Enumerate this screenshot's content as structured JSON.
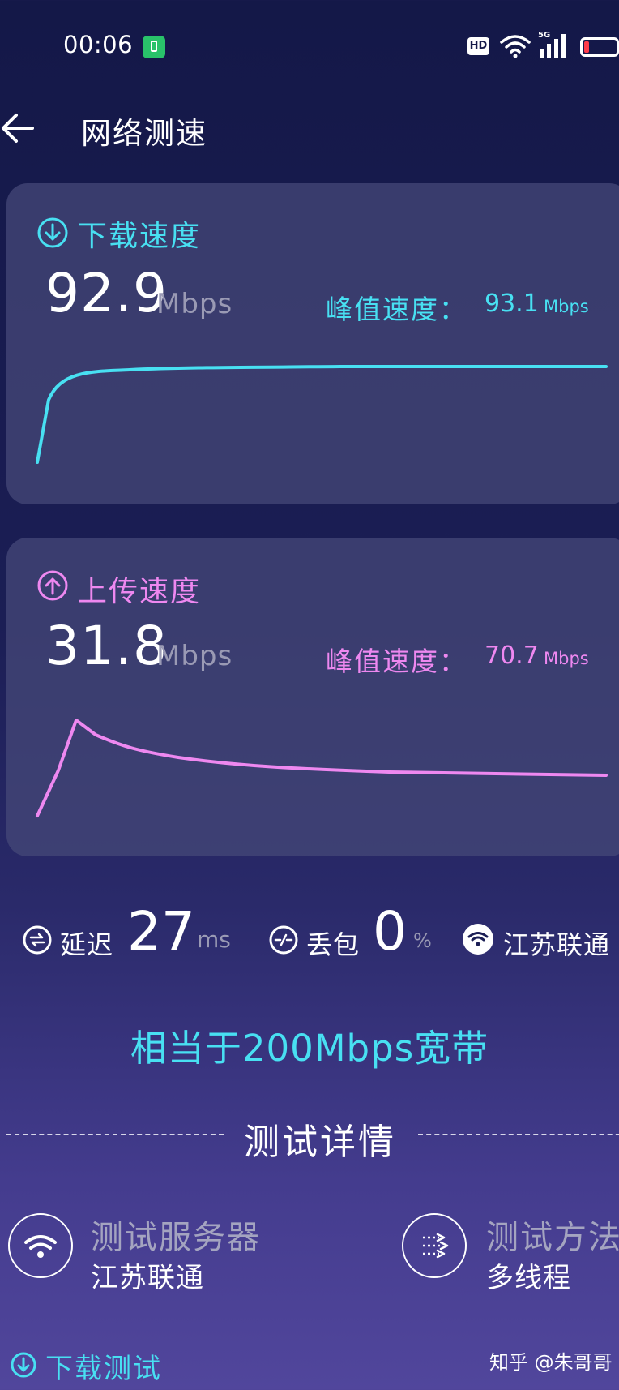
{
  "status_bar": {
    "time": "00:06",
    "hd_badge": "HD",
    "network_type": "5G"
  },
  "header": {
    "title": "网络测速"
  },
  "download": {
    "label": "下载速度",
    "speed": "92.9",
    "unit": "Mbps",
    "peak_label": "峰值速度：",
    "peak_value": "93.1",
    "peak_unit": "Mbps",
    "color": "#48e0f2"
  },
  "upload": {
    "label": "上传速度",
    "speed": "31.8",
    "unit": "Mbps",
    "peak_label": "峰值速度：",
    "peak_value": "70.7",
    "peak_unit": "Mbps",
    "color": "#ee88f0"
  },
  "stats": {
    "latency_label": "延迟",
    "latency_value": "27",
    "latency_unit": "ms",
    "loss_label": "丢包",
    "loss_value": "0",
    "loss_unit": "%",
    "carrier": "江苏联通"
  },
  "equivalent": "相当于200Mbps宽带",
  "details": {
    "title": "测试详情",
    "server_label": "测试服务器",
    "server_value": "江苏联通",
    "method_label": "测试方法",
    "method_value": "多线程"
  },
  "bottom_link": "下载测试",
  "watermark": "知乎 @朱哥哥",
  "colors": {
    "background_top": "#141848",
    "background_bottom": "#51469c",
    "card": "#464878"
  }
}
